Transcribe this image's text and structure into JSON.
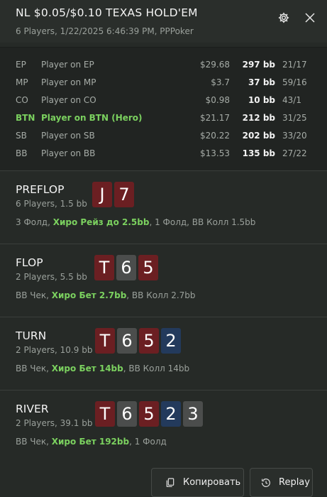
{
  "header": {
    "title": "NL $0.05/$0.10 TEXAS HOLD'EM",
    "subtitle": "6 Players, 1/22/2025 6:46:39 PM, PPPoker"
  },
  "players": [
    {
      "pos": "EP",
      "name": "Player on EP",
      "amount": "$29.68",
      "bb": "297 bb",
      "stats": "21/17",
      "hero": false
    },
    {
      "pos": "MP",
      "name": "Player on MP",
      "amount": "$3.7",
      "bb": "37 bb",
      "stats": "59/16",
      "hero": false
    },
    {
      "pos": "CO",
      "name": "Player on CO",
      "amount": "$0.98",
      "bb": "10 bb",
      "stats": "43/1",
      "hero": false
    },
    {
      "pos": "BTN",
      "name": "Player on BTN (Hero)",
      "amount": "$21.17",
      "bb": "212 bb",
      "stats": "31/25",
      "hero": true
    },
    {
      "pos": "SB",
      "name": "Player on SB",
      "amount": "$20.22",
      "bb": "202 bb",
      "stats": "33/20",
      "hero": false
    },
    {
      "pos": "BB",
      "name": "Player on BB",
      "amount": "$13.53",
      "bb": "135 bb",
      "stats": "27/22",
      "hero": false
    }
  ],
  "streets": [
    {
      "name": "PREFLOP",
      "info": "6 Players, 1.5 bb",
      "cards": [
        {
          "rank": "J",
          "color": "red"
        },
        {
          "rank": "7",
          "color": "red"
        }
      ],
      "actions": [
        {
          "text": "3 Фолд, ",
          "highlight": false
        },
        {
          "text": "Хиро Рейз до 2.5bb",
          "highlight": true
        },
        {
          "text": ", 1 Фолд, BB Колл 1.5bb",
          "highlight": false
        }
      ]
    },
    {
      "name": "FLOP",
      "info": "2 Players, 5.5 bb",
      "cards": [
        {
          "rank": "T",
          "color": "red"
        },
        {
          "rank": "6",
          "color": "gray"
        },
        {
          "rank": "5",
          "color": "red"
        }
      ],
      "actions": [
        {
          "text": "BB Чек, ",
          "highlight": false
        },
        {
          "text": "Хиро Бет 2.7bb",
          "highlight": true
        },
        {
          "text": ", BB Колл 2.7bb",
          "highlight": false
        }
      ]
    },
    {
      "name": "TURN",
      "info": "2 Players, 10.9 bb",
      "cards": [
        {
          "rank": "T",
          "color": "red"
        },
        {
          "rank": "6",
          "color": "gray"
        },
        {
          "rank": "5",
          "color": "red"
        },
        {
          "rank": "2",
          "color": "blue"
        }
      ],
      "actions": [
        {
          "text": "BB Чек, ",
          "highlight": false
        },
        {
          "text": "Хиро Бет 14bb",
          "highlight": true
        },
        {
          "text": ", BB Колл 14bb",
          "highlight": false
        }
      ]
    },
    {
      "name": "RIVER",
      "info": "2 Players, 39.1 bb",
      "cards": [
        {
          "rank": "T",
          "color": "red"
        },
        {
          "rank": "6",
          "color": "gray"
        },
        {
          "rank": "5",
          "color": "red"
        },
        {
          "rank": "2",
          "color": "blue"
        },
        {
          "rank": "3",
          "color": "gray"
        }
      ],
      "actions": [
        {
          "text": "BB Чек, ",
          "highlight": false
        },
        {
          "text": "Хиро Бет 192bb",
          "highlight": true
        },
        {
          "text": ", 1 Фолд",
          "highlight": false
        }
      ]
    }
  ],
  "buttons": {
    "copy_label": "Копировать",
    "replay_label": "Replay"
  },
  "icons": {
    "settings": "gear-icon",
    "close": "close-icon",
    "copy": "copy-icon",
    "replay": "replay-icon"
  },
  "colors": {
    "hero_highlight": "#7bd15f",
    "card_red": "#6b1f22",
    "card_gray": "#4b4d4c",
    "card_blue": "#233a5c"
  }
}
